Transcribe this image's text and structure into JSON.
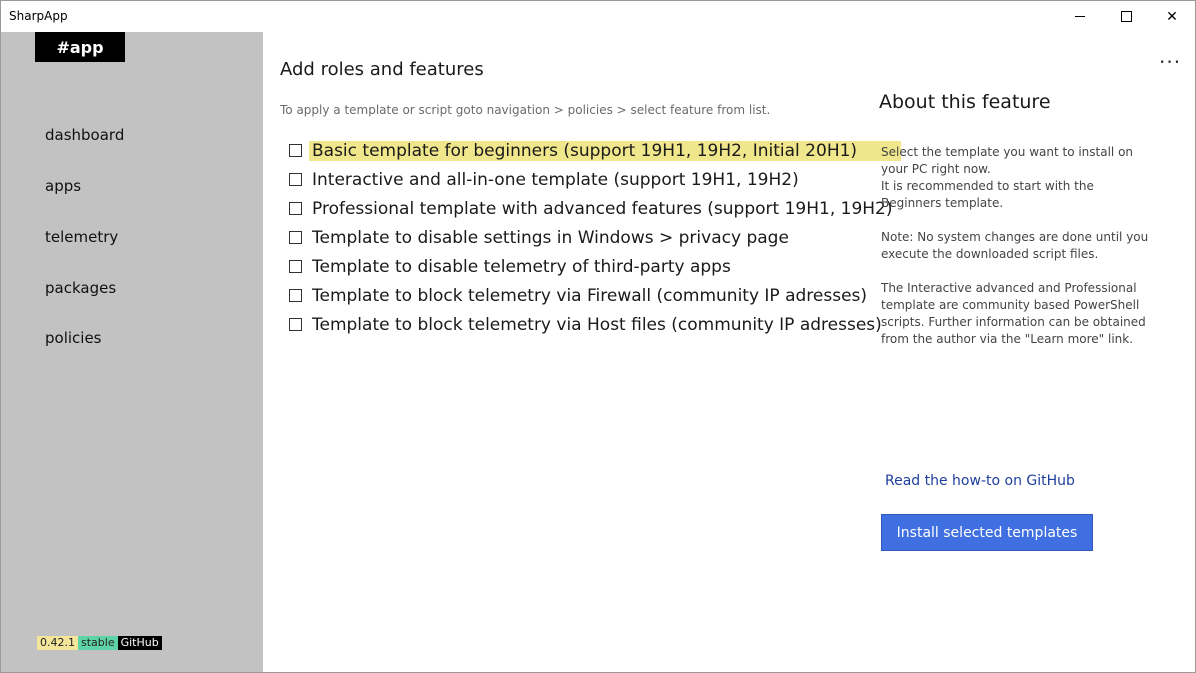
{
  "window": {
    "title": "SharpApp",
    "close_glyph": "✕"
  },
  "sidebar": {
    "brand": "#app",
    "items": [
      {
        "label": "dashboard"
      },
      {
        "label": "apps"
      },
      {
        "label": "telemetry"
      },
      {
        "label": "packages"
      },
      {
        "label": "policies"
      }
    ],
    "badges": {
      "version": "0.42.1",
      "channel": "stable",
      "github": "GitHub"
    }
  },
  "main": {
    "title": "Add roles and features",
    "hint": "To apply a template or script goto navigation > policies > select feature from list.",
    "more_glyph": "···",
    "templates": [
      {
        "label": "Basic template for beginners (support 19H1, 19H2, Initial 20H1)",
        "selected": true
      },
      {
        "label": "Interactive and all-in-one template (support 19H1, 19H2)",
        "selected": false
      },
      {
        "label": "Professional template with advanced features (support 19H1, 19H2)",
        "selected": false
      },
      {
        "label": "Template to disable settings in Windows > privacy page",
        "selected": false
      },
      {
        "label": "Template to disable telemetry of third-party apps",
        "selected": false
      },
      {
        "label": "Template to block telemetry via Firewall (community IP adresses)",
        "selected": false
      },
      {
        "label": "Template to block telemetry via Host files (community IP adresses)",
        "selected": false
      }
    ]
  },
  "about": {
    "title": "About this feature",
    "paragraphs": [
      "Select the template you want to install on your PC right now.\nIt is recommended to start with the Beginners template.",
      "Note: No system changes are done until you execute the downloaded script files.",
      "The Interactive advanced and Professional template are community based PowerShell scripts. Further information can be obtained from the author via the \"Learn more\" link."
    ],
    "howto_link": "Read the how-to on GitHub",
    "install_button": "Install selected templates"
  },
  "colors": {
    "sidebar_bg": "#c2c2c2",
    "selection_highlight": "#f0e68c",
    "install_button": "#3f6fe0",
    "link": "#1e3f9e",
    "badge_version": "#f3e69a",
    "badge_stable": "#5fd3a8"
  }
}
